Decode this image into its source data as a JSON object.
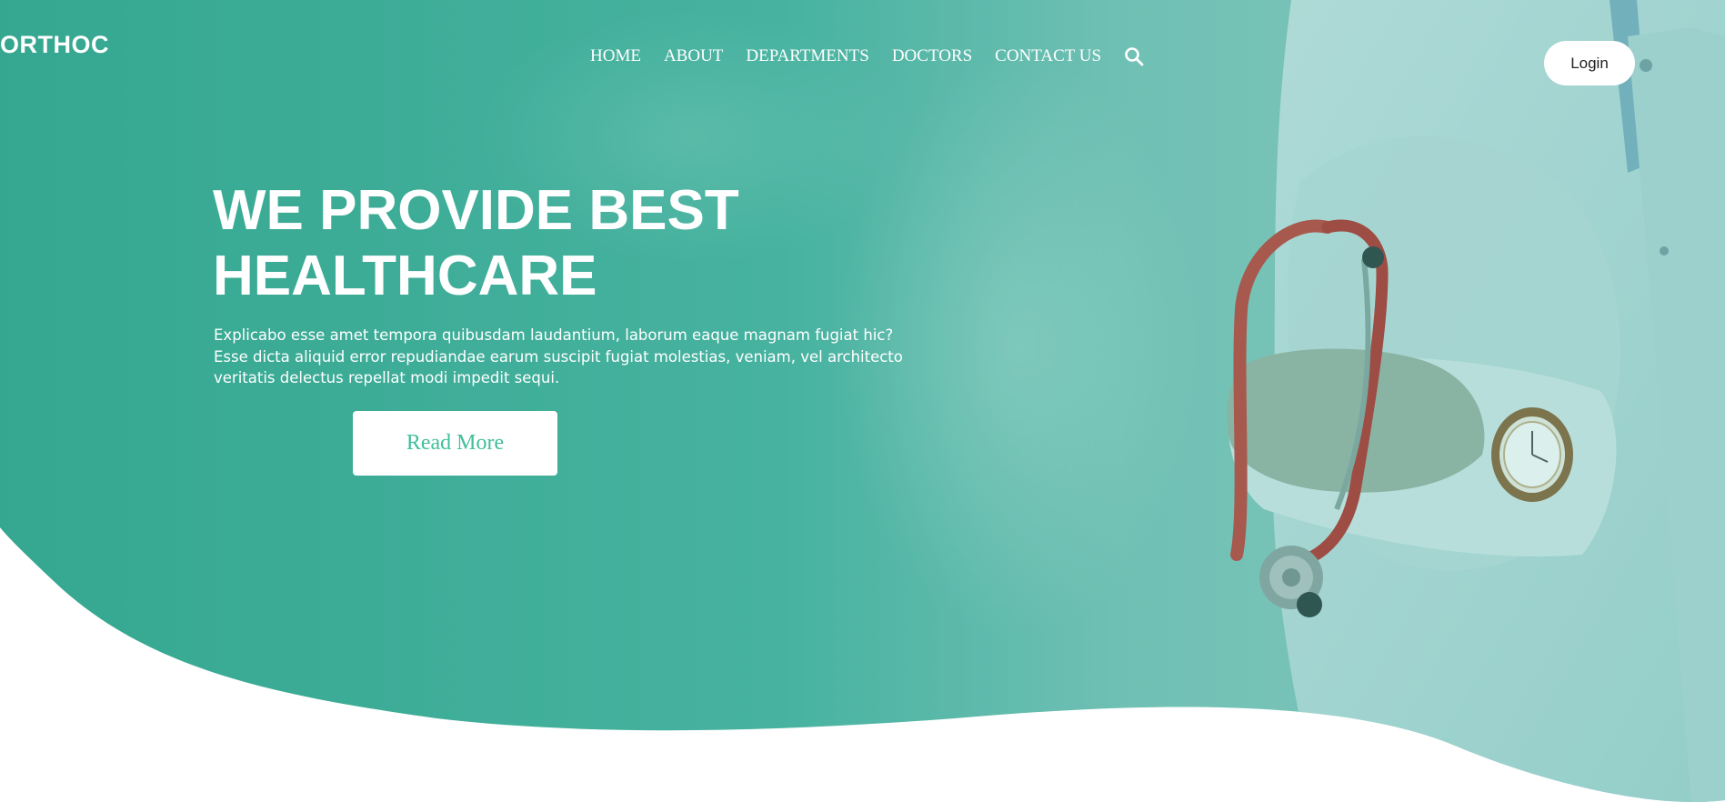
{
  "brand": {
    "logo_text": "ORTHOC"
  },
  "nav": {
    "items": [
      {
        "label": "HOME"
      },
      {
        "label": "ABOUT"
      },
      {
        "label": "DEPARTMENTS"
      },
      {
        "label": "DOCTORS"
      },
      {
        "label": "CONTACT US"
      }
    ],
    "search_icon": "search-icon"
  },
  "header": {
    "login_label": "Login"
  },
  "hero": {
    "title_line1": "WE PROVIDE BEST",
    "title_line2": "HEALTHCARE",
    "description": "Explicabo esse amet tempora quibusdam laudantium, laborum eaque magnam fugiat hic? Esse dicta aliquid error repudiandae earum suscipit fugiat molestias, veniam, vel architecto veritatis delectus repellat modi impedit sequi.",
    "read_more_label": "Read More",
    "image": "doctor-with-stethoscope-image"
  },
  "colors": {
    "accent": "#3fbf9a",
    "hero_overlay": "#3aa996",
    "text_on_hero": "#ffffff"
  }
}
